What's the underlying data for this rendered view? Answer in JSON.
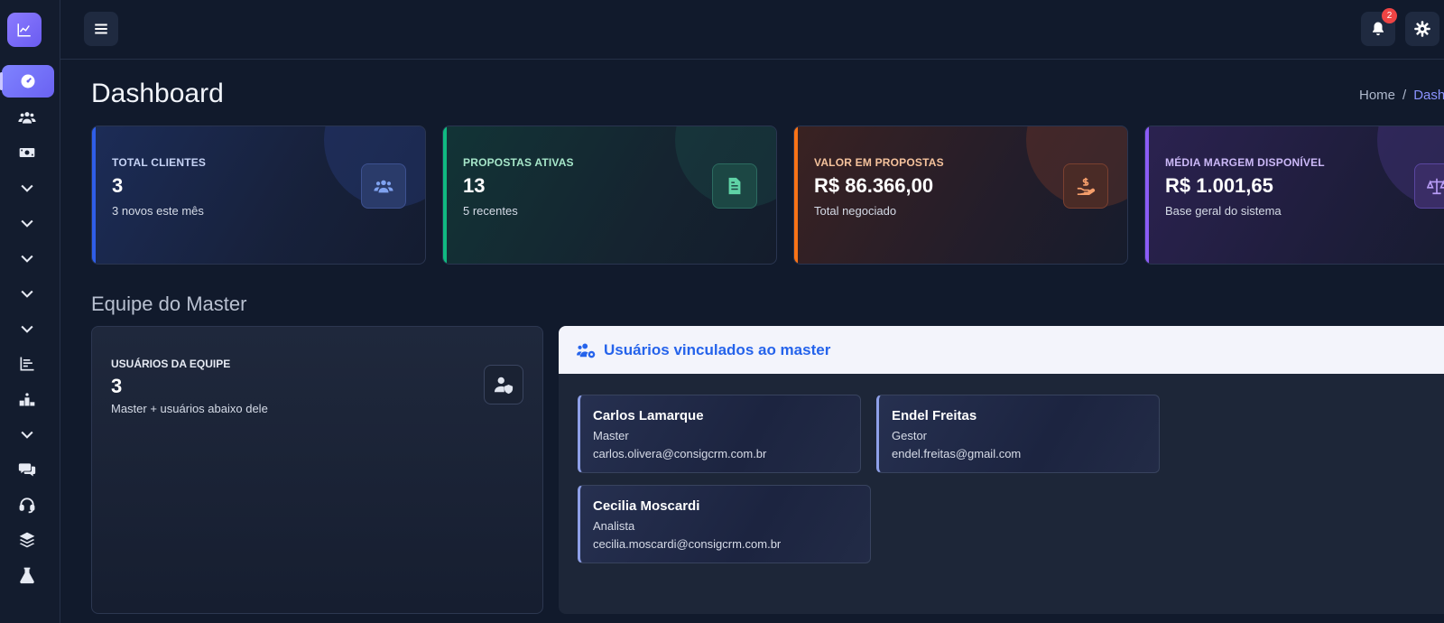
{
  "topbar": {
    "notification_count": "2"
  },
  "page": {
    "title": "Dashboard",
    "breadcrumb": {
      "home": "Home",
      "separator": "/",
      "current": "Dashboard"
    }
  },
  "stats": [
    {
      "label": "TOTAL CLIENTES",
      "value": "3",
      "sub": "3 novos este mês",
      "icon": "users-icon",
      "accent": "#2f5ee8"
    },
    {
      "label": "PROPOSTAS ATIVAS",
      "value": "13",
      "sub": "5 recentes",
      "icon": "file-invoice-icon",
      "accent": "#10b981"
    },
    {
      "label": "VALOR EM PROPOSTAS",
      "value": "R$ 86.366,00",
      "sub": "Total negociado",
      "icon": "hand-dollar-icon",
      "accent": "#f97316"
    },
    {
      "label": "MÉDIA MARGEM DISPONÍVEL",
      "value": "R$ 1.001,65",
      "sub": "Base geral do sistema",
      "icon": "balance-scale-icon",
      "accent": "#8b5cf6"
    }
  ],
  "team": {
    "section_title": "Equipe do Master",
    "card": {
      "label": "USUÁRIOS DA EQUIPE",
      "value": "3",
      "sub": "Master + usuários abaixo dele"
    }
  },
  "users_panel": {
    "title": "Usuários vinculados ao master",
    "users": [
      {
        "name": "Carlos Lamarque",
        "role": "Master",
        "email": "carlos.olivera@consigcrm.com.br"
      },
      {
        "name": "Endel Freitas",
        "role": "Gestor",
        "email": "endel.freitas@gmail.com"
      },
      {
        "name": "Cecilia Moscardi",
        "role": "Analista",
        "email": "cecilia.moscardi@consigcrm.com.br"
      }
    ]
  },
  "colors": {
    "accent": "#6a62f2",
    "link": "#2563eb",
    "background": "#111a2c"
  }
}
